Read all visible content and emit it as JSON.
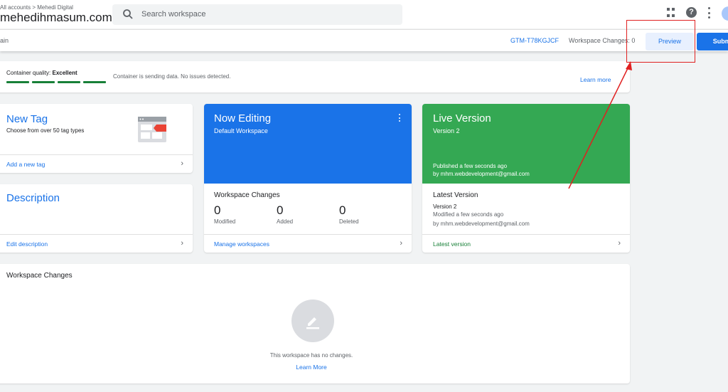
{
  "header": {
    "breadcrumb": "All accounts > Mehedi Digital",
    "account_name": "mehedihmasum.com",
    "search_placeholder": "Search workspace"
  },
  "subbar": {
    "workspace_label": "ain",
    "container_id": "GTM-T78KGJCF",
    "workspace_changes": "Workspace Changes: 0",
    "preview_label": "Preview",
    "submit_label": "Submit"
  },
  "quality": {
    "label": "Container quality:",
    "value": "Excellent",
    "message": "Container is sending data. No issues detected.",
    "link": "Learn more"
  },
  "new_tag": {
    "title": "New Tag",
    "subtitle": "Choose from over 50 tag types",
    "link": "Add a new tag"
  },
  "description": {
    "title": "Description",
    "link": "Edit description"
  },
  "now_editing": {
    "title": "Now Editing",
    "subtitle": "Default Workspace",
    "changes_title": "Workspace Changes",
    "stats": [
      {
        "value": "0",
        "label": "Modified"
      },
      {
        "value": "0",
        "label": "Added"
      },
      {
        "value": "0",
        "label": "Deleted"
      }
    ],
    "link": "Manage workspaces"
  },
  "live_version": {
    "title": "Live Version",
    "subtitle": "Version 2",
    "published": "Published a few seconds ago",
    "published_by": "by mhm.webdevelopment@gmail.com",
    "latest_title": "Latest Version",
    "latest_version": "Version 2",
    "modified": "Modified a few seconds ago",
    "modified_by": "by mhm.webdevelopment@gmail.com",
    "link": "Latest version"
  },
  "workspace_changes_panel": {
    "title": "Workspace Changes",
    "empty_message": "This workspace has no changes.",
    "link": "Learn More"
  },
  "colors": {
    "primary": "#1a73e8",
    "live_green": "#34a853",
    "annotation_red": "#e02020"
  }
}
